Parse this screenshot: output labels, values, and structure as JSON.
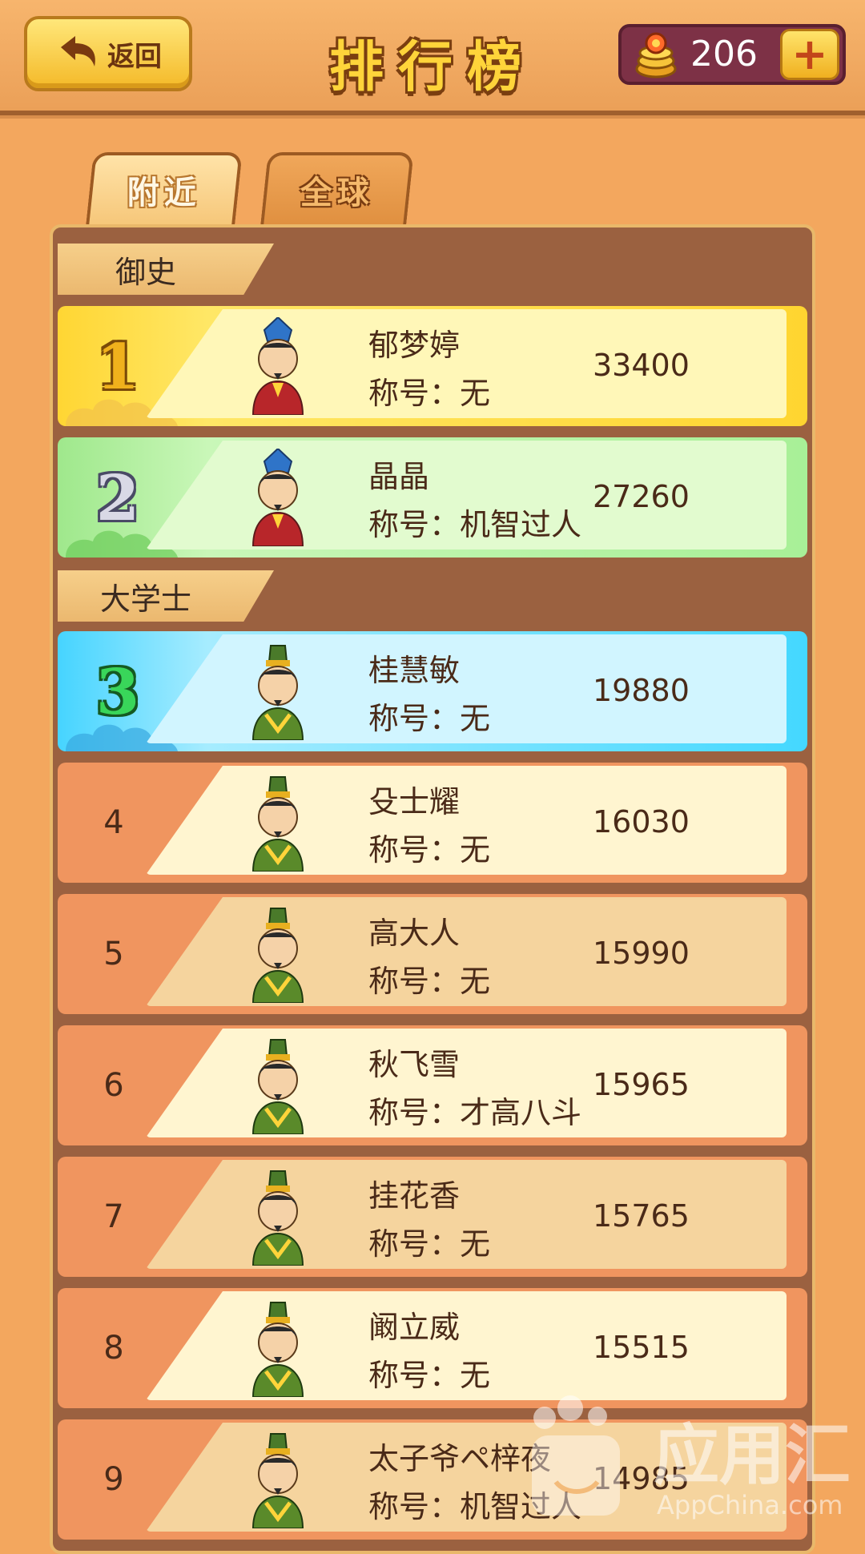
{
  "header": {
    "back_label": "返回",
    "title": "排行榜",
    "coins": "206",
    "plus_label": "+"
  },
  "tabs": [
    {
      "label": "附近",
      "active": true
    },
    {
      "label": "全球",
      "active": false
    }
  ],
  "sections": [
    {
      "label": "御史"
    },
    {
      "label": "大学士"
    }
  ],
  "rows": [
    {
      "rank": "1",
      "name": "郁梦婷",
      "title": "称号：无",
      "score": "33400"
    },
    {
      "rank": "2",
      "name": "晶晶",
      "title": "称号：机智过人",
      "score": "27260"
    },
    {
      "rank": "3",
      "name": "桂慧敏",
      "title": "称号：无",
      "score": "19880"
    },
    {
      "rank": "4",
      "name": "殳士耀",
      "title": "称号：无",
      "score": "16030"
    },
    {
      "rank": "5",
      "name": "高大人",
      "title": "称号：无",
      "score": "15990"
    },
    {
      "rank": "6",
      "name": "秋飞雪",
      "title": "称号：才高八斗",
      "score": "15965"
    },
    {
      "rank": "7",
      "name": "挂花香",
      "title": "称号：无",
      "score": "15765"
    },
    {
      "rank": "8",
      "name": "阚立威",
      "title": "称号：无",
      "score": "15515"
    },
    {
      "rank": "9",
      "name": "太子爷ペ梓夜",
      "title": "称号：机智过人",
      "score": "14985"
    }
  ],
  "watermark": {
    "text": "应用汇",
    "sub": "AppChina.com"
  }
}
